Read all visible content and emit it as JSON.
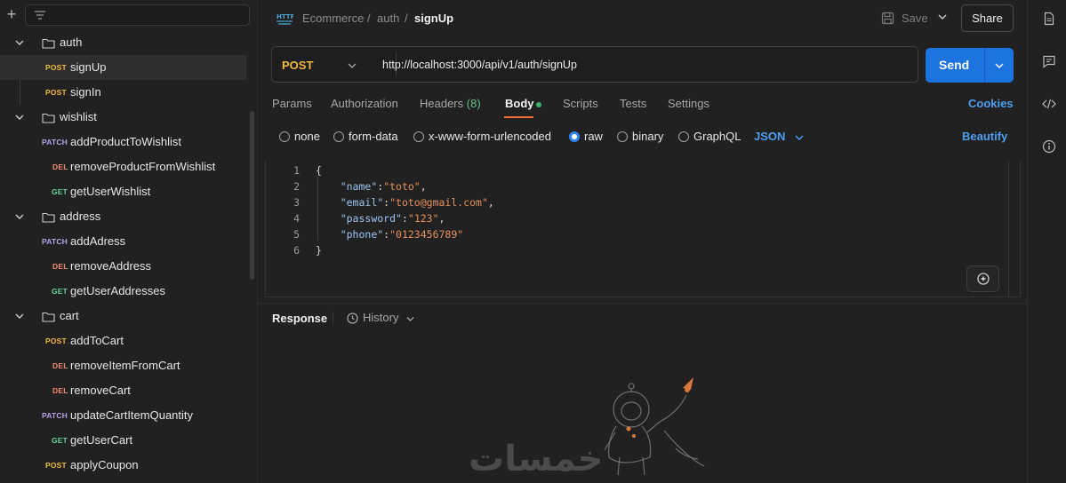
{
  "sidebar": {
    "tree": [
      {
        "kind": "folder",
        "name": "auth"
      },
      {
        "kind": "request",
        "method": "POST",
        "name": "signUp",
        "selected": true
      },
      {
        "kind": "request",
        "method": "POST",
        "name": "signIn"
      },
      {
        "kind": "folder",
        "name": "wishlist"
      },
      {
        "kind": "request",
        "method": "PATCH",
        "name": "addProductToWishlist"
      },
      {
        "kind": "request",
        "method": "DEL",
        "name": "removeProductFromWishlist"
      },
      {
        "kind": "request",
        "method": "GET",
        "name": "getUserWishlist"
      },
      {
        "kind": "folder",
        "name": "address"
      },
      {
        "kind": "request",
        "method": "PATCH",
        "name": "addAdress"
      },
      {
        "kind": "request",
        "method": "DEL",
        "name": "removeAddress"
      },
      {
        "kind": "request",
        "method": "GET",
        "name": "getUserAddresses"
      },
      {
        "kind": "folder",
        "name": "cart"
      },
      {
        "kind": "request",
        "method": "POST",
        "name": "addToCart"
      },
      {
        "kind": "request",
        "method": "DEL",
        "name": "removeItemFromCart"
      },
      {
        "kind": "request",
        "method": "DEL",
        "name": "removeCart"
      },
      {
        "kind": "request",
        "method": "PATCH",
        "name": "updateCartItemQuantity"
      },
      {
        "kind": "request",
        "method": "GET",
        "name": "getUserCart"
      },
      {
        "kind": "request",
        "method": "POST",
        "name": "applyCoupon"
      }
    ]
  },
  "header": {
    "http_badge": "HTTP",
    "breadcrumb": [
      "Ecommerce",
      "auth",
      "signUp"
    ],
    "separator": "/",
    "save_label": "Save",
    "share_label": "Share"
  },
  "request": {
    "method": "POST",
    "url": "http://localhost:3000/api/v1/auth/signUp",
    "send_label": "Send"
  },
  "tabs": {
    "params": "Params",
    "authorization": "Authorization",
    "headers": "Headers",
    "headers_count": "(8)",
    "body": "Body",
    "scripts": "Scripts",
    "tests": "Tests",
    "settings": "Settings",
    "cookies": "Cookies"
  },
  "body_types": {
    "none": "none",
    "form_data": "form-data",
    "urlencoded": "x-www-form-urlencoded",
    "raw": "raw",
    "binary": "binary",
    "graphql": "GraphQL",
    "format": "JSON",
    "beautify": "Beautify",
    "selected": "raw"
  },
  "editor": {
    "line_numbers": [
      "1",
      "2",
      "3",
      "4",
      "5",
      "6"
    ],
    "open_brace": "{",
    "close_brace": "}",
    "fields": [
      {
        "key": "\"name\"",
        "value": "\"toto\"",
        "comma": ","
      },
      {
        "key": "\"email\"",
        "value": "\"toto@gmail.com\"",
        "comma": ","
      },
      {
        "key": "\"password\"",
        "value": "\"123\"",
        "comma": ","
      },
      {
        "key": "\"phone\"",
        "value": "\"0123456789\"",
        "comma": ""
      }
    ]
  },
  "response": {
    "label": "Response",
    "history_label": "History"
  },
  "watermark": "خمسات",
  "colors": {
    "accent": "#1c74e0",
    "post": "#f1b93e",
    "get": "#6bd19a",
    "delete": "#ef8d6d",
    "patch": "#b6a1e4",
    "link": "#4d9ef0",
    "tab_underline": "#ef6c3a"
  }
}
